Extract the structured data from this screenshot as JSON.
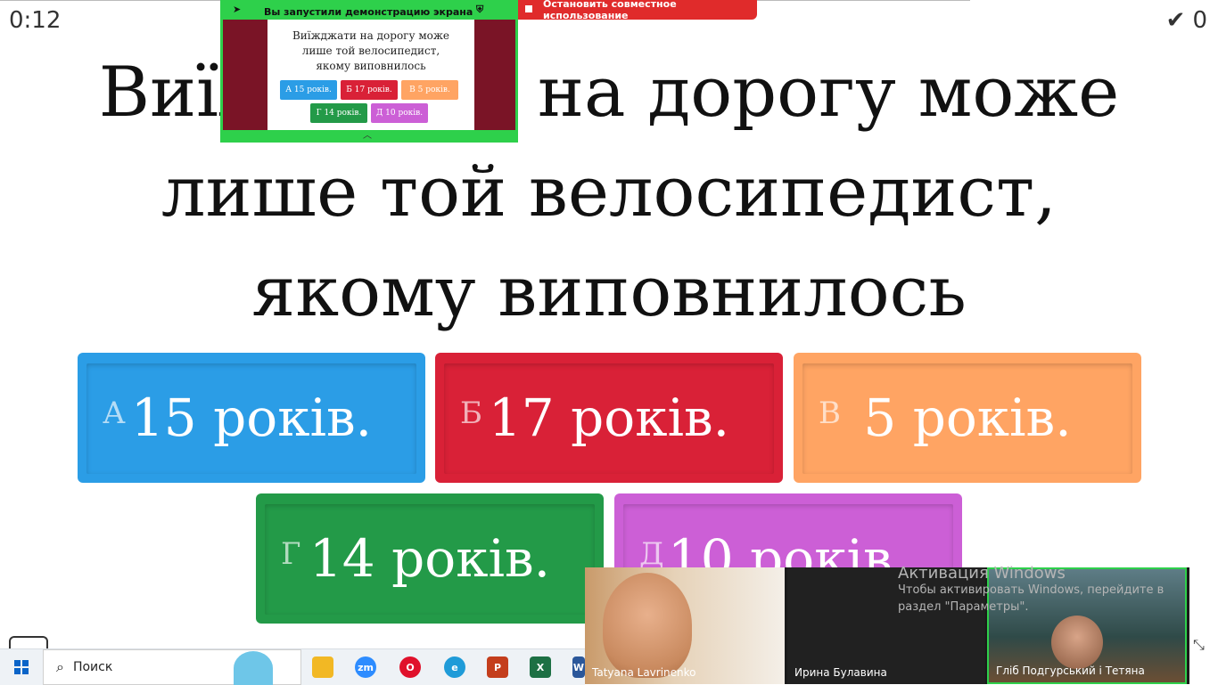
{
  "header": {
    "timer": "0:12",
    "score": "0",
    "check_icon": "checkmark-icon"
  },
  "question": {
    "line1": "Виїжджати на дорогу може",
    "line2": "лише той велосипедист,",
    "line3": "якому виповнилось"
  },
  "answers": [
    {
      "letter": "А",
      "text": "15 років.",
      "color": "#2b9de6"
    },
    {
      "letter": "Б",
      "text": "17 років.",
      "color": "#d92137"
    },
    {
      "letter": "В",
      "text": "5 років.",
      "color": "#ffa463"
    },
    {
      "letter": "Г",
      "text": "14 років.",
      "color": "#239a48"
    },
    {
      "letter": "Д",
      "text": "10 років.",
      "color": "#cc5fd6"
    }
  ],
  "screen_share": {
    "banner_text": "Вы запустили демонстрацию экрана",
    "stop_button": "Остановить совместное использование",
    "preview_question": "Виїжджати на дорогу може лише той велосипедист, якому виповнилось"
  },
  "video_participants": [
    {
      "name": "Tatyana Lavrinenko"
    },
    {
      "name": "Ирина Булавина"
    },
    {
      "name": "Гліб Подгурський і Тетяна"
    }
  ],
  "windows_activation": {
    "title": "Активация Windows",
    "line1": "Чтобы активировать Windows, перейдите в",
    "line2": "раздел \"Параметры\"."
  },
  "taskbar": {
    "search_placeholder": "Поиск",
    "apps": [
      "file-explorer-icon",
      "zoom-icon",
      "opera-icon",
      "edge-icon",
      "powerpoint-icon",
      "excel-icon",
      "word-icon"
    ]
  }
}
